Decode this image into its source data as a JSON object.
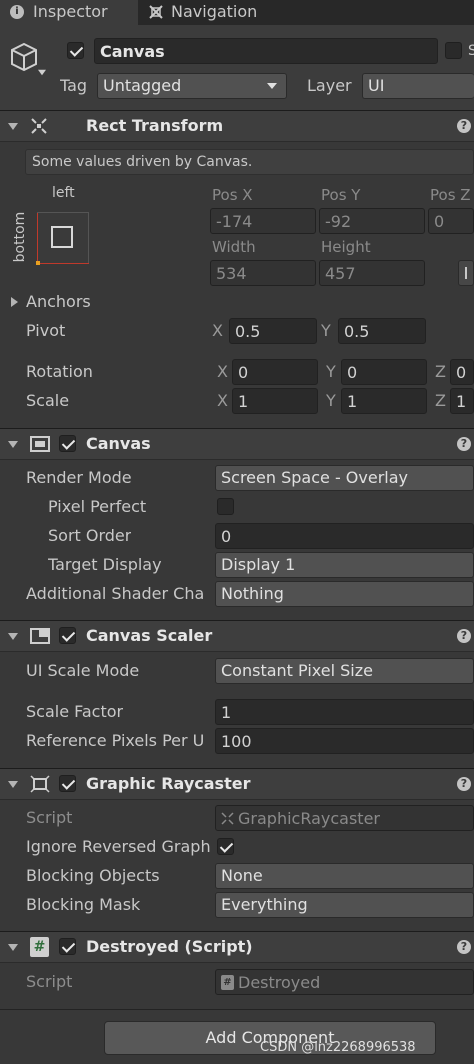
{
  "tabs": [
    {
      "label": "Inspector",
      "icon": "info-icon"
    },
    {
      "label": "Navigation",
      "icon": "navigation-icon"
    }
  ],
  "header": {
    "object_name": "Canvas",
    "active": true,
    "tag_label": "Tag",
    "tag_value": "Untagged",
    "layer_label": "Layer",
    "layer_value": "UI",
    "static_label": "S"
  },
  "rect_transform": {
    "title": "Rect Transform",
    "info": "Some values driven by Canvas.",
    "anchor_h": "left",
    "anchor_v": "bottom",
    "pos_x_label": "Pos X",
    "pos_y_label": "Pos Y",
    "pos_z_label": "Pos Z",
    "pos_x": "-174",
    "pos_y": "-92",
    "pos_z": "0",
    "width_label": "Width",
    "height_label": "Height",
    "width": "534",
    "height": "457",
    "anchors_label": "Anchors",
    "pivot_label": "Pivot",
    "pivot_x": "0.5",
    "pivot_y": "0.5",
    "rotation_label": "Rotation",
    "rot_x": "0",
    "rot_y": "0",
    "rot_z": "0",
    "scale_label": "Scale",
    "scale_x": "1",
    "scale_y": "1",
    "scale_z": "1",
    "axis_x": "X",
    "axis_y": "Y",
    "axis_z": "Z"
  },
  "canvas": {
    "title": "Canvas",
    "render_mode_label": "Render Mode",
    "render_mode": "Screen Space - Overlay",
    "pixel_perfect_label": "Pixel Perfect",
    "sort_order_label": "Sort Order",
    "sort_order": "0",
    "target_display_label": "Target Display",
    "target_display": "Display 1",
    "shader_label": "Additional Shader Cha",
    "shader_value": "Nothing"
  },
  "canvas_scaler": {
    "title": "Canvas Scaler",
    "ui_scale_mode_label": "UI Scale Mode",
    "ui_scale_mode": "Constant Pixel Size",
    "scale_factor_label": "Scale Factor",
    "scale_factor": "1",
    "ref_ppu_label": "Reference Pixels Per U",
    "ref_ppu": "100"
  },
  "graphic_raycaster": {
    "title": "Graphic Raycaster",
    "script_label": "Script",
    "script_value": "GraphicRaycaster",
    "ignore_label": "Ignore Reversed Graph",
    "blocking_objects_label": "Blocking Objects",
    "blocking_objects": "None",
    "blocking_mask_label": "Blocking Mask",
    "blocking_mask": "Everything"
  },
  "destroyed": {
    "title": "Destroyed (Script)",
    "script_label": "Script",
    "script_value": "Destroyed"
  },
  "add_component_label": "Add Component",
  "watermark": "CSDN @lnz2268996538"
}
